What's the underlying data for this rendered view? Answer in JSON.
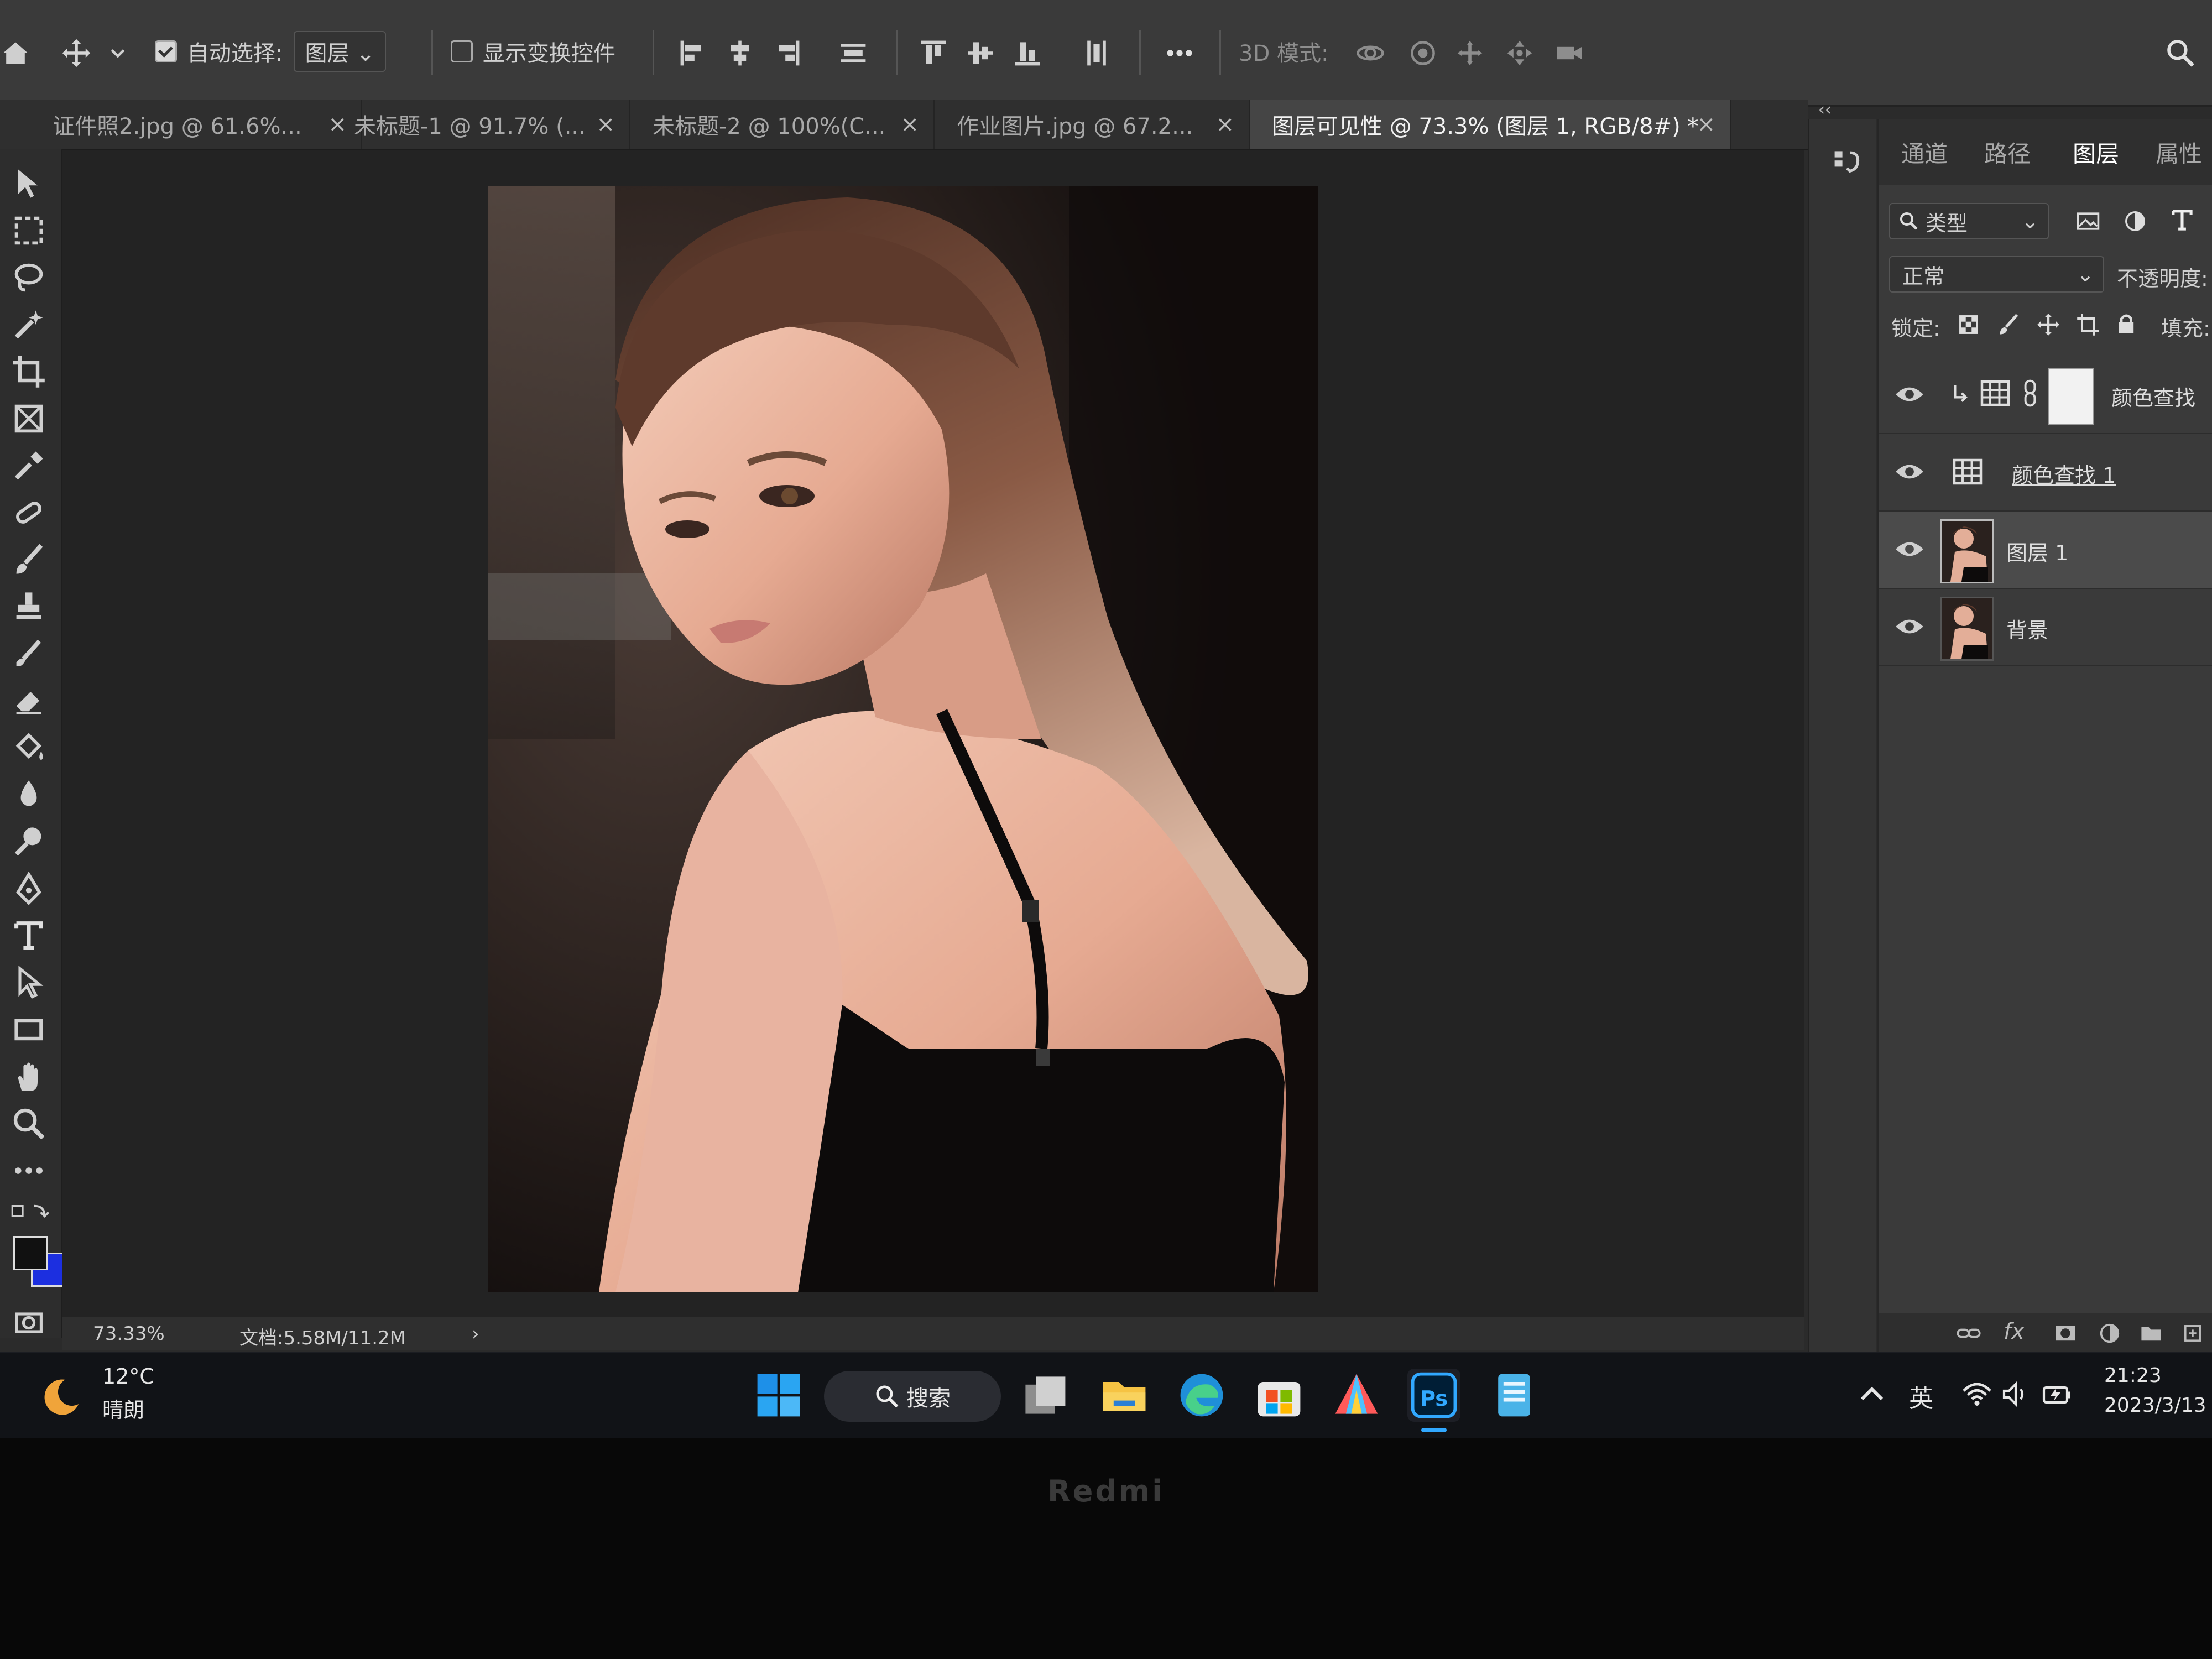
{
  "options_bar": {
    "auto_select_label": "自动选择:",
    "auto_select_checked": true,
    "auto_select_target": "图层",
    "show_transform_label": "显示变换控件",
    "show_transform_checked": false,
    "mode_3d_label": "3D 模式:"
  },
  "tabs": [
    {
      "label": "证件照2.jpg @ 61.6%...",
      "active": false
    },
    {
      "label": "未标题-1 @ 91.7% (...",
      "active": false
    },
    {
      "label": "未标题-2 @ 100%(C...",
      "active": false
    },
    {
      "label": "作业图片.jpg @ 67.2...",
      "active": false
    },
    {
      "label": "图层可见性 @ 73.3% (图层 1, RGB/8#) *",
      "active": true
    }
  ],
  "close_glyph": "×",
  "status": {
    "zoom": "73.33%",
    "doc_size": "文档:5.58M/11.2M",
    "arrow": "›"
  },
  "panel": {
    "collapse_glyph": "‹‹",
    "tabs": [
      {
        "label": "通道",
        "active": false
      },
      {
        "label": "路径",
        "active": false
      },
      {
        "label": "图层",
        "active": true
      },
      {
        "label": "属性",
        "active": false
      }
    ],
    "filter_kind": "类型",
    "blend_mode": "正常",
    "opacity_label": "不透明度:",
    "lock_label": "锁定:",
    "fill_label": "填充:",
    "layers": [
      {
        "name": "颜色查找",
        "kind": "adjustment-clipped",
        "visible": true,
        "selected": false
      },
      {
        "name": "颜色查找 1",
        "kind": "adjustment",
        "visible": true,
        "selected": false
      },
      {
        "name": "图层 1",
        "kind": "pixel",
        "visible": true,
        "selected": true
      },
      {
        "name": "背景",
        "kind": "pixel",
        "visible": true,
        "selected": false
      }
    ]
  },
  "taskbar": {
    "weather_temp": "12°C",
    "weather_desc": "晴朗",
    "search_label": "搜索",
    "tray_lang": "英",
    "time": "21:23",
    "date": "2023/3/13"
  },
  "laptop_brand": "Redmi",
  "colors": {
    "accent_blue": "#1a4fd6",
    "foreground_swatch": "#111111",
    "background_swatch": "#1c2fe0",
    "windows_blue": "#1e90e8",
    "ps_blue": "#31a8ff"
  }
}
